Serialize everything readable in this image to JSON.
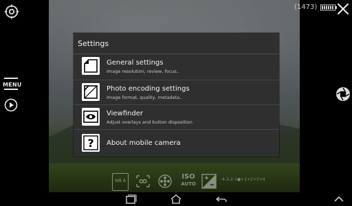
{
  "status": {
    "counter": "(1473)"
  },
  "left_controls": {
    "menu_label": "MENU"
  },
  "settings_modal": {
    "title": "Settings",
    "items": [
      {
        "title": "General settings",
        "subtitle": "Image resolution, review, focus.."
      },
      {
        "title": "Photo encoding settings",
        "subtitle": "Image format, quality, metadata.."
      },
      {
        "title": "Viewfinder",
        "subtitle": "Adjust overlays and button disposition"
      },
      {
        "title": "About mobile camera",
        "subtitle": ""
      }
    ]
  },
  "camera_controls": {
    "white_balance_label": "WB A",
    "iso_top": "ISO",
    "iso_bottom": "AUTO",
    "ev_scale": "-4-3-2-1●+1+2+3+4"
  },
  "colors": {
    "modal_bg": "#2f2f2f",
    "icon_bg": "#ffffff",
    "text": "#f3f3f3"
  }
}
